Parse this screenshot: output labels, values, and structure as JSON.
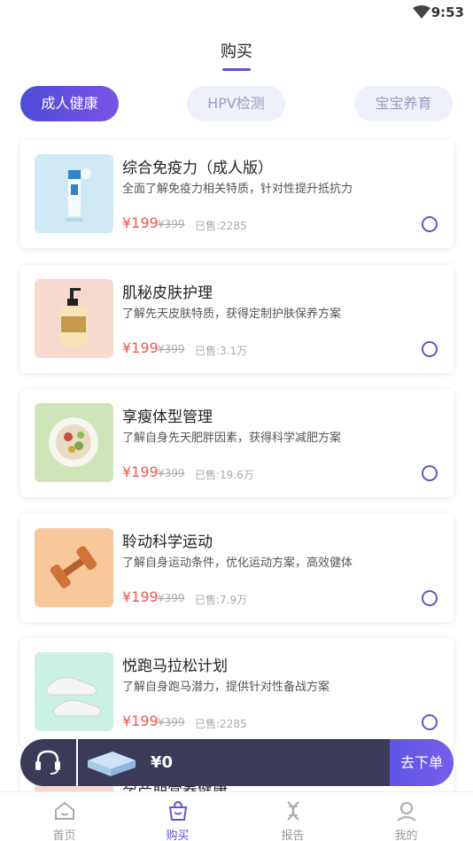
{
  "status": {
    "time": "9:53"
  },
  "header": {
    "title": "购买"
  },
  "tabs": [
    {
      "label": "成人健康",
      "active": true
    },
    {
      "label": "HPV检测",
      "active": false
    },
    {
      "label": "宝宝养育",
      "active": false
    }
  ],
  "products": [
    {
      "name": "综合免疫力（成人版）",
      "desc": "全面了解免疫力相关特质，针对性提升抵抗力",
      "price": "¥199",
      "original": "¥399",
      "sold": "已售:2285",
      "thumb": "immunity-bottle"
    },
    {
      "name": "肌秘皮肤护理",
      "desc": "了解先天皮肤特质，获得定制护肤保养方案",
      "price": "¥199",
      "original": "¥399",
      "sold": "已售:3.1万",
      "thumb": "lotion-bottle"
    },
    {
      "name": "享瘦体型管理",
      "desc": "了解自身先天肥胖因素，获得科学减肥方案",
      "price": "¥199",
      "original": "¥399",
      "sold": "已售:19.6万",
      "thumb": "salad-plate"
    },
    {
      "name": "聆动科学运动",
      "desc": "了解自身运动条件，优化运动方案，高效健体",
      "price": "¥199",
      "original": "¥399",
      "sold": "已售:7.9万",
      "thumb": "dumbbells"
    },
    {
      "name": "悦跑马拉松计划",
      "desc": "了解自身跑马潜力，提供针对性备战方案",
      "price": "¥199",
      "original": "¥399",
      "sold": "已售:2285",
      "thumb": "sneakers"
    }
  ],
  "peek_item": {
    "name": "孕产期营养健康"
  },
  "cart": {
    "total": "¥0",
    "order_label": "去下单"
  },
  "nav": [
    {
      "label": "首页",
      "icon": "home-icon",
      "active": false
    },
    {
      "label": "购买",
      "icon": "shopping-bag-icon",
      "active": true
    },
    {
      "label": "报告",
      "icon": "dna-icon",
      "active": false
    },
    {
      "label": "我的",
      "icon": "user-icon",
      "active": false
    }
  ],
  "colors": {
    "accent": "#5b57d6",
    "price": "#f0584a",
    "cart_bar": "#3b3a58"
  }
}
